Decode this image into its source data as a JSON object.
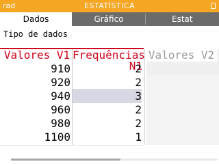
{
  "status_bar": {
    "angle_mode": "rad",
    "app_title": "ESTATÍSTICA",
    "battery_icon": "battery-icon"
  },
  "tabs": [
    {
      "label": "Dados",
      "active": true
    },
    {
      "label": "Gráfico",
      "active": false
    },
    {
      "label": "Estat",
      "active": false
    }
  ],
  "section_label": "Tipo de dados",
  "table": {
    "headers": {
      "v1": "Valores V1",
      "n1": "Frequências N1",
      "v2": "Valores V2"
    },
    "rows": [
      {
        "v1": "910",
        "n1": "2"
      },
      {
        "v1": "920",
        "n1": "2"
      },
      {
        "v1": "940",
        "n1": "3"
      },
      {
        "v1": "960",
        "n1": "2"
      },
      {
        "v1": "980",
        "n1": "2"
      },
      {
        "v1": "1100",
        "n1": "1"
      }
    ],
    "selected_row_index": 2
  },
  "colors": {
    "accent": "#f5a623",
    "header_red": "#d0021b"
  }
}
